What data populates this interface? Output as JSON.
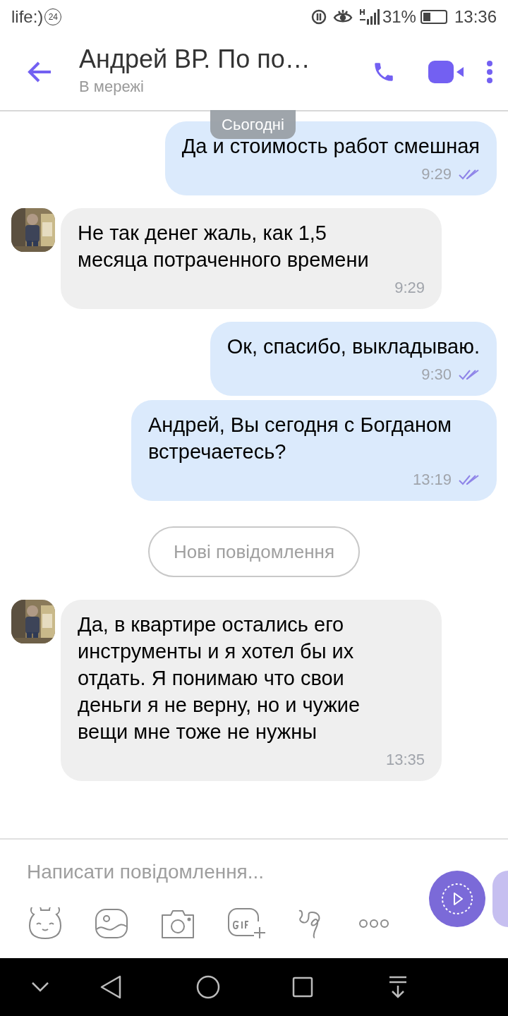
{
  "status_bar": {
    "carrier": "life:)",
    "carrier_badge": "24",
    "battery_percent": "31%",
    "time": "13:36"
  },
  "header": {
    "title": "Андрей ВР. По по…",
    "subtitle": "В мережі"
  },
  "date_badge": "Сьогодні",
  "messages": [
    {
      "kind": "outgoing",
      "text": "Да и стоимость работ смешная",
      "time": "9:29",
      "read": true
    },
    {
      "kind": "incoming",
      "text": "Не так денег жаль, как 1,5 месяца потраченного времени",
      "time": "9:29"
    },
    {
      "kind": "outgoing",
      "text": "Ок, спасибо, выкладываю.",
      "time": "9:30",
      "read": true
    },
    {
      "kind": "outgoing",
      "text": "Андрей, Вы сегодня с Богданом встречаетесь?",
      "time": "13:19",
      "read": true
    },
    {
      "kind": "divider",
      "text": "Нові повідомлення"
    },
    {
      "kind": "incoming",
      "text": "Да, в квартире остались его инструменты и я хотел бы их отдать. Я понимаю что свои деньги я не верну, но и чужие вещи мне тоже не нужны",
      "time": "13:35"
    }
  ],
  "composer": {
    "placeholder": "Написати повідомлення..."
  }
}
